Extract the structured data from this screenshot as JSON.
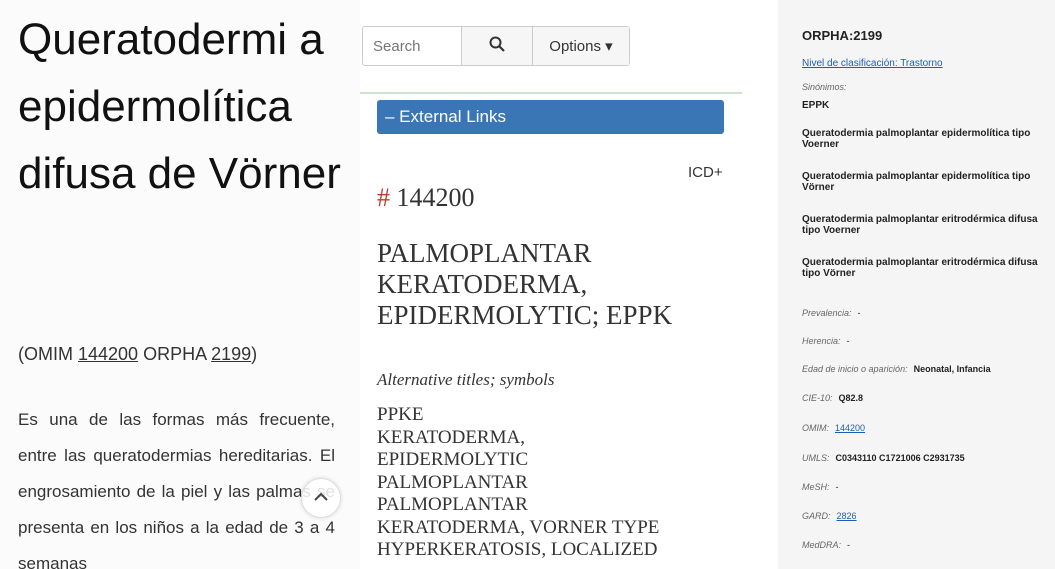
{
  "left": {
    "title": "Queratodermi a epidermolítica difusa de Vörner",
    "omim_prefix": "(OMIM ",
    "omim_number": "144200",
    "orpha_prefix": " ORPHA ",
    "orpha_number": "2199",
    "omim_suffix": ")",
    "paragraph": "Es una de las formas más frecuente, entre las queratodermias hereditarias. El engrosamiento de la piel y las palmas se presenta en los niños a la edad de 3 a 4 semanas"
  },
  "middle": {
    "search_placeholder": "Search",
    "options_label": "Options ▾",
    "external_links_label": "– External Links",
    "icd_label": "ICD+",
    "entry_hash": "#",
    "entry_number": "144200",
    "entry_title": "PALMOPLANTAR KERATODERMA, EPIDERMOLYTIC; EPPK",
    "alt_titles_heading": "Alternative titles; symbols",
    "alt_titles": [
      "PPKE",
      "KERATODERMA,",
      "EPIDERMOLYTIC",
      "PALMOPLANTAR",
      "PALMOPLANTAR",
      "KERATODERMA, VORNER TYPE",
      "HYPERKERATOSIS, LOCALIZED"
    ]
  },
  "right": {
    "orpha_id": "ORPHA:2199",
    "nivel_link": "Nivel de clasificación: Trastorno",
    "synonyms_heading": "Sinónimos:",
    "synonyms": [
      "EPPK",
      "Queratodermia palmoplantar epidermolítica tipo Voerner",
      "Queratodermia palmoplantar epidermolítica tipo Vörner",
      "Queratodermia palmoplantar eritrodérmica difusa tipo Voerner",
      "Queratodermia palmoplantar eritrodérmica difusa tipo Vörner"
    ],
    "fields": {
      "prevalencia_label": "Prevalencia:",
      "prevalencia_value": "-",
      "herencia_label": "Herencia:",
      "herencia_value": "-",
      "edad_label": "Edad de inicio o aparición:",
      "edad_value": "Neonatal, Infancia",
      "cie_label": "CIE-10:",
      "cie_value": "Q82.8",
      "omim_label": "OMIM:",
      "omim_value": "144200",
      "umls_label": "UMLS:",
      "umls_value": "C0343110 C1721006 C2931735",
      "mesh_label": "MeSH:",
      "mesh_value": "-",
      "gard_label": "GARD:",
      "gard_value": "2826",
      "meddra_label": "MedDRA:",
      "meddra_value": "-"
    }
  },
  "colors": {
    "accent_blue": "#3a76b5",
    "link_blue": "#1a5fb4",
    "hash_red": "#c0392b"
  }
}
